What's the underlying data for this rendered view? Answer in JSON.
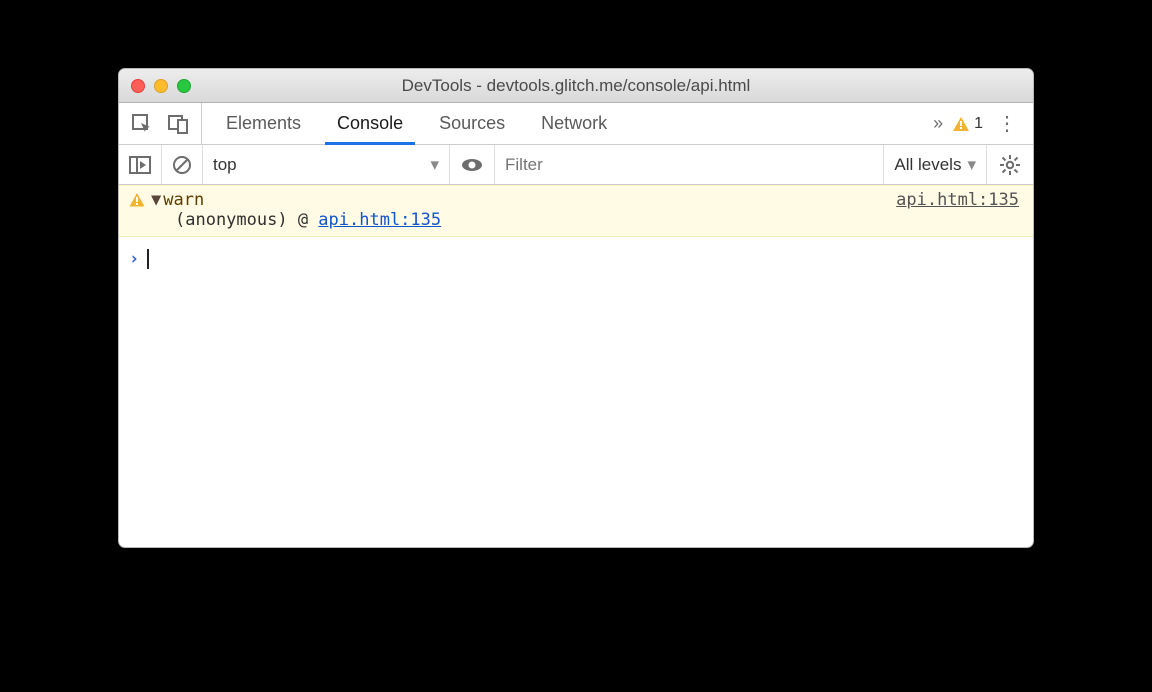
{
  "window": {
    "title": "DevTools - devtools.glitch.me/console/api.html"
  },
  "tabs": {
    "items": [
      "Elements",
      "Console",
      "Sources",
      "Network"
    ],
    "active_index": 1,
    "warning_count": "1"
  },
  "filterbar": {
    "context": "top",
    "filter_placeholder": "Filter",
    "levels_label": "All levels"
  },
  "console": {
    "warning": {
      "label": "warn",
      "source_link": "api.html:135",
      "trace_prefix": "(anonymous) @ ",
      "trace_link": "api.html:135"
    }
  }
}
